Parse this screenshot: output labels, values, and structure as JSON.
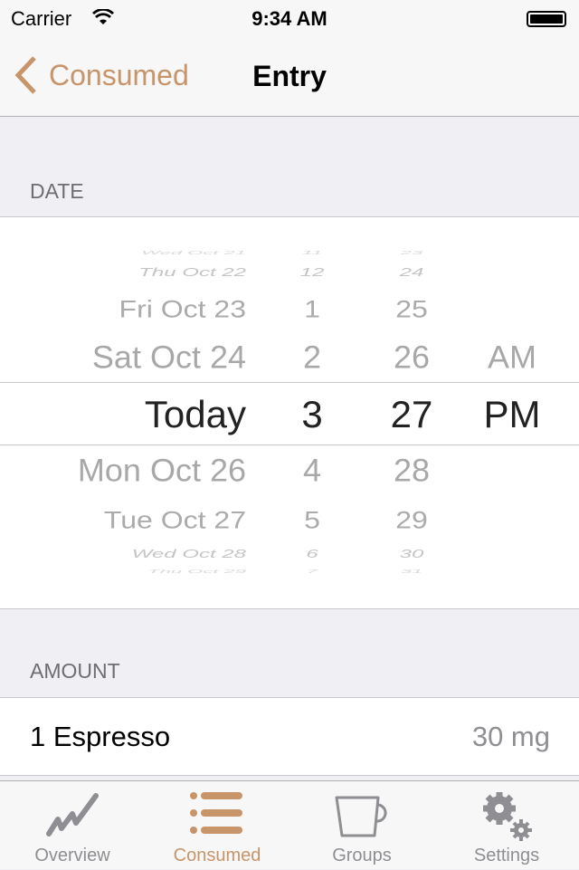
{
  "status": {
    "carrier": "Carrier",
    "time": "9:34 AM"
  },
  "nav": {
    "back": "Consumed",
    "title": "Entry"
  },
  "date_section": {
    "header": "DATE"
  },
  "picker": {
    "rows": [
      {
        "date": "Wed Oct 21",
        "hour": "11",
        "minute": "23",
        "ampm": ""
      },
      {
        "date": "Thu Oct 22",
        "hour": "12",
        "minute": "24",
        "ampm": ""
      },
      {
        "date": "Fri Oct 23",
        "hour": "1",
        "minute": "25",
        "ampm": ""
      },
      {
        "date": "Sat Oct 24",
        "hour": "2",
        "minute": "26",
        "ampm": "AM"
      },
      {
        "date": "Today",
        "hour": "3",
        "minute": "27",
        "ampm": "PM"
      },
      {
        "date": "Mon Oct 26",
        "hour": "4",
        "minute": "28",
        "ampm": ""
      },
      {
        "date": "Tue Oct 27",
        "hour": "5",
        "minute": "29",
        "ampm": ""
      },
      {
        "date": "Wed Oct 28",
        "hour": "6",
        "minute": "30",
        "ampm": ""
      },
      {
        "date": "Thu Oct 29",
        "hour": "7",
        "minute": "31",
        "ampm": ""
      }
    ]
  },
  "amount_section": {
    "header": "AMOUNT",
    "item": "1 Espresso",
    "value": "30 mg"
  },
  "tabs": [
    {
      "label": "Overview",
      "icon": "chart-line-icon"
    },
    {
      "label": "Consumed",
      "icon": "list-icon",
      "active": true
    },
    {
      "label": "Groups",
      "icon": "cup-icon"
    },
    {
      "label": "Settings",
      "icon": "gear-icon"
    }
  ],
  "colors": {
    "accent": "#c8946a",
    "inactive": "#8e8e93"
  }
}
